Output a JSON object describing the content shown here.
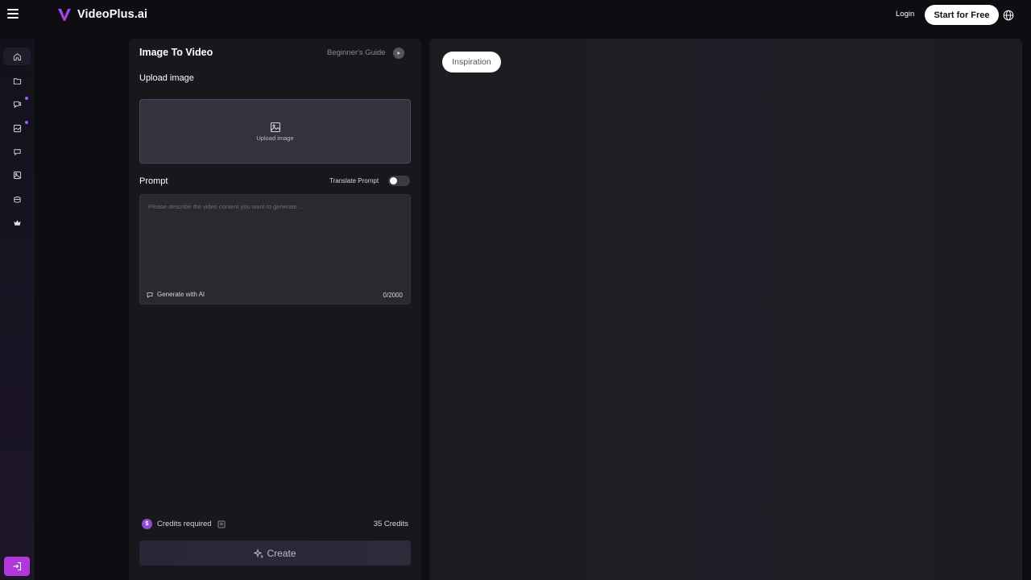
{
  "header": {
    "brand": "VideoPlus.ai",
    "login_label": "Login",
    "start_label": "Start for Free"
  },
  "sidebar": {
    "items": [
      {
        "icon": "home-icon",
        "active": true
      },
      {
        "icon": "folder-icon"
      },
      {
        "icon": "video-chat-icon",
        "dot": true
      },
      {
        "icon": "image-video-icon",
        "dot": true
      },
      {
        "icon": "chat-bubble-icon"
      },
      {
        "icon": "image-gallery-icon"
      },
      {
        "icon": "box-icon"
      },
      {
        "icon": "crown-icon"
      }
    ],
    "login_icon": "login-arrow-icon"
  },
  "editor": {
    "title": "Image To Video",
    "guide_label": "Beginner's Guide",
    "upload_section_label": "Upload image",
    "upload_box_text": "Upload image",
    "prompt_label": "Prompt",
    "translate_label": "Translate Prompt",
    "translate_on": false,
    "prompt_placeholder": "Please describe the video content you want to generate ...",
    "prompt_value": "",
    "generate_ai_label": "Generate with AI",
    "char_counter": "0/2000",
    "credits_coin": "$",
    "credits_label": "Credits required",
    "credits_value": "35 Credits",
    "create_label": "Create"
  },
  "gallery": {
    "inspiration_label": "Inspiration"
  },
  "colors": {
    "accent": "#a855f7",
    "login_button": "#b139d9",
    "background": "#0d0d12"
  }
}
